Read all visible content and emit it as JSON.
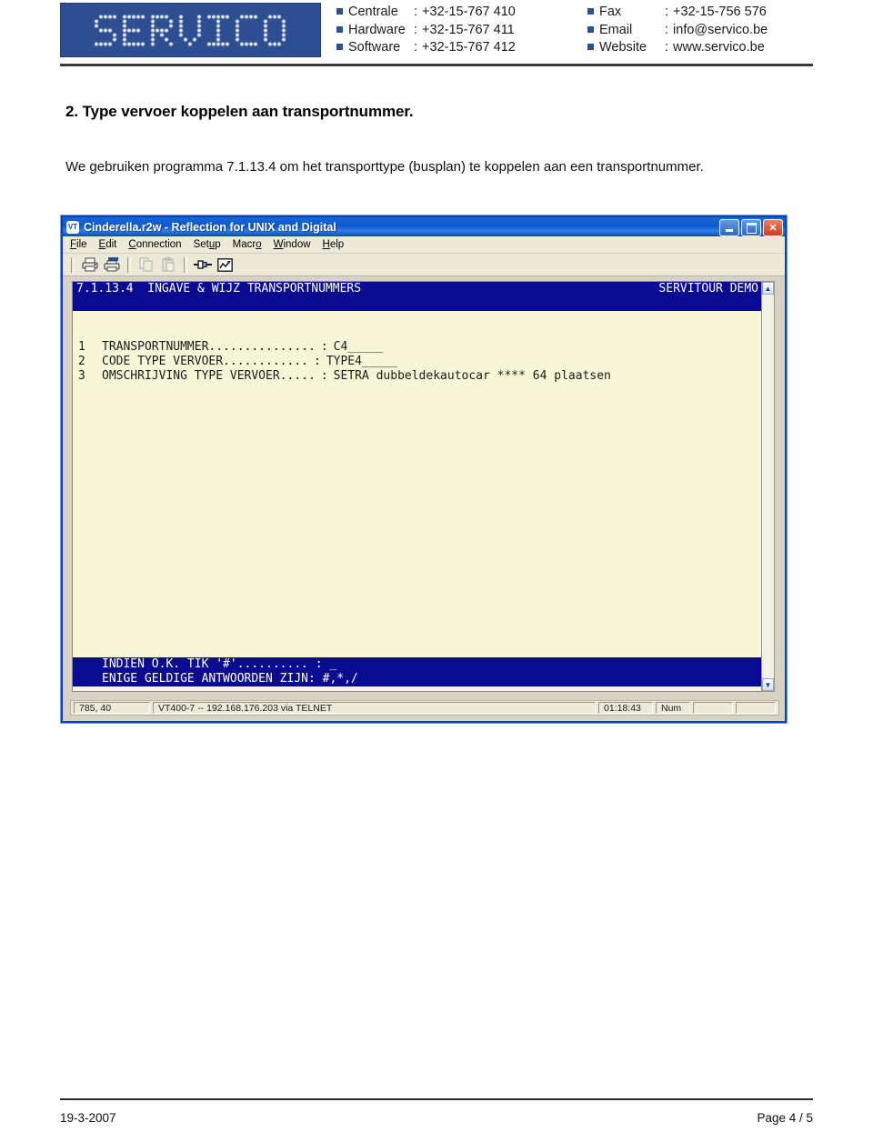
{
  "header": {
    "logo_text": "SERVICO",
    "contact_left": [
      {
        "label": "Centrale",
        "sep": ":",
        "value": "+32-15-767 410"
      },
      {
        "label": "Hardware",
        "sep": ":",
        "value": "+32-15-767 411"
      },
      {
        "label": "Software",
        "sep": ":",
        "value": "+32-15-767 412"
      }
    ],
    "contact_right": [
      {
        "label": "Fax",
        "sep": ":",
        "value": "+32-15-756 576"
      },
      {
        "label": "Email",
        "sep": ":",
        "value": "info@servico.be"
      },
      {
        "label": "Website",
        "sep": ":",
        "value": "www.servico.be"
      }
    ]
  },
  "document": {
    "section_title": "2. Type vervoer koppelen aan transportnummer.",
    "paragraph": "We gebruiken programma 7.1.13.4 om het transporttype (busplan) te koppelen aan een transportnummer."
  },
  "terminal_window": {
    "title": "Cinderella.r2w - Reflection for UNIX and Digital",
    "app_icon": "vt-icon",
    "app_icon_text": "VT",
    "window_buttons": {
      "minimize": "minimize-button",
      "maximize": "maximize-button",
      "close": "✕"
    },
    "menu": [
      {
        "label": "File",
        "mnemonic": "F"
      },
      {
        "label": "Edit",
        "mnemonic": "E"
      },
      {
        "label": "Connection",
        "mnemonic": "C"
      },
      {
        "label": "Setup",
        "mnemonic": "u"
      },
      {
        "label": "Macro",
        "mnemonic": "o"
      },
      {
        "label": "Window",
        "mnemonic": "W"
      },
      {
        "label": "Help",
        "mnemonic": "H"
      }
    ],
    "toolbar": [
      {
        "name": "print-icon",
        "enabled": true
      },
      {
        "name": "print-preview-icon",
        "enabled": true
      },
      {
        "name": "copy-icon",
        "enabled": false
      },
      {
        "name": "paste-icon",
        "enabled": false
      },
      {
        "name": "connect-icon",
        "enabled": true
      },
      {
        "name": "trace-icon",
        "enabled": true
      }
    ],
    "screen": {
      "header_left": "7.1.13.4  INGAVE & WIJZ TRANSPORTNUMMERS",
      "header_right": "SERVITOUR DEMO",
      "fields": [
        {
          "num": "1",
          "label": "TRANSPORTNUMMER...............",
          "sep": ":",
          "value": "C4_____"
        },
        {
          "num": "2",
          "label": "CODE TYPE VERVOER............",
          "sep": ":",
          "value": "TYPE4_____"
        },
        {
          "num": "3",
          "label": "OMSCHRIJVING TYPE VERVOER.....",
          "sep": ":",
          "value": "SETRA dubbeldekautocar **** 64 plaatsen"
        }
      ],
      "prompt_line_1": "INDIEN O.K. TIK '#'.......... : _",
      "prompt_line_2": "ENIGE GELDIGE ANTWOORDEN ZIJN: #,*,/",
      "colors": {
        "background": "#f7f7d8",
        "highlight_bg": "#0b0b91",
        "highlight_fg": "#ffffff",
        "text": "#1b1b1b"
      }
    },
    "scrollbar": {
      "up": "▲",
      "down": "▼"
    },
    "status_bar": {
      "cursor_position": "785, 40",
      "connection": "VT400-7 -- 192.168.176.203 via TELNET",
      "time": "01:18:43",
      "num_lock": "Num"
    }
  },
  "footer": {
    "date": "19-3-2007",
    "page": "Page 4 / 5"
  },
  "theme": {
    "brand_blue": "#2d4f92",
    "title_blue": "#0d59cd",
    "terminal_navy": "#0b0b91",
    "terminal_paper": "#f7f7d8"
  }
}
